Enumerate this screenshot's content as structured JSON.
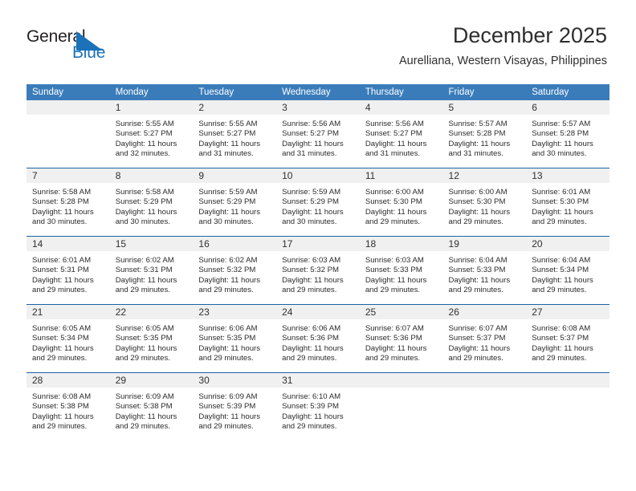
{
  "brand": {
    "name_part1": "General",
    "name_part2": "Blue",
    "logo_colors": {
      "blue": "#1b72b8",
      "dark": "#231f20"
    }
  },
  "header": {
    "title": "December 2025",
    "subtitle": "Aurelliana, Western Visayas, Philippines"
  },
  "colors": {
    "header_blue": "#3a7cba",
    "row_divider_blue": "#1b63a5",
    "daynum_band": "#f0f0f0"
  },
  "weekday_headers": [
    "Sunday",
    "Monday",
    "Tuesday",
    "Wednesday",
    "Thursday",
    "Friday",
    "Saturday"
  ],
  "weeks": [
    [
      {
        "day": "",
        "sunrise": "",
        "sunset": "",
        "daylight_line1": "",
        "daylight_line2": ""
      },
      {
        "day": "1",
        "sunrise": "Sunrise: 5:55 AM",
        "sunset": "Sunset: 5:27 PM",
        "daylight_line1": "Daylight: 11 hours",
        "daylight_line2": "and 32 minutes."
      },
      {
        "day": "2",
        "sunrise": "Sunrise: 5:55 AM",
        "sunset": "Sunset: 5:27 PM",
        "daylight_line1": "Daylight: 11 hours",
        "daylight_line2": "and 31 minutes."
      },
      {
        "day": "3",
        "sunrise": "Sunrise: 5:56 AM",
        "sunset": "Sunset: 5:27 PM",
        "daylight_line1": "Daylight: 11 hours",
        "daylight_line2": "and 31 minutes."
      },
      {
        "day": "4",
        "sunrise": "Sunrise: 5:56 AM",
        "sunset": "Sunset: 5:27 PM",
        "daylight_line1": "Daylight: 11 hours",
        "daylight_line2": "and 31 minutes."
      },
      {
        "day": "5",
        "sunrise": "Sunrise: 5:57 AM",
        "sunset": "Sunset: 5:28 PM",
        "daylight_line1": "Daylight: 11 hours",
        "daylight_line2": "and 31 minutes."
      },
      {
        "day": "6",
        "sunrise": "Sunrise: 5:57 AM",
        "sunset": "Sunset: 5:28 PM",
        "daylight_line1": "Daylight: 11 hours",
        "daylight_line2": "and 30 minutes."
      }
    ],
    [
      {
        "day": "7",
        "sunrise": "Sunrise: 5:58 AM",
        "sunset": "Sunset: 5:28 PM",
        "daylight_line1": "Daylight: 11 hours",
        "daylight_line2": "and 30 minutes."
      },
      {
        "day": "8",
        "sunrise": "Sunrise: 5:58 AM",
        "sunset": "Sunset: 5:29 PM",
        "daylight_line1": "Daylight: 11 hours",
        "daylight_line2": "and 30 minutes."
      },
      {
        "day": "9",
        "sunrise": "Sunrise: 5:59 AM",
        "sunset": "Sunset: 5:29 PM",
        "daylight_line1": "Daylight: 11 hours",
        "daylight_line2": "and 30 minutes."
      },
      {
        "day": "10",
        "sunrise": "Sunrise: 5:59 AM",
        "sunset": "Sunset: 5:29 PM",
        "daylight_line1": "Daylight: 11 hours",
        "daylight_line2": "and 30 minutes."
      },
      {
        "day": "11",
        "sunrise": "Sunrise: 6:00 AM",
        "sunset": "Sunset: 5:30 PM",
        "daylight_line1": "Daylight: 11 hours",
        "daylight_line2": "and 29 minutes."
      },
      {
        "day": "12",
        "sunrise": "Sunrise: 6:00 AM",
        "sunset": "Sunset: 5:30 PM",
        "daylight_line1": "Daylight: 11 hours",
        "daylight_line2": "and 29 minutes."
      },
      {
        "day": "13",
        "sunrise": "Sunrise: 6:01 AM",
        "sunset": "Sunset: 5:30 PM",
        "daylight_line1": "Daylight: 11 hours",
        "daylight_line2": "and 29 minutes."
      }
    ],
    [
      {
        "day": "14",
        "sunrise": "Sunrise: 6:01 AM",
        "sunset": "Sunset: 5:31 PM",
        "daylight_line1": "Daylight: 11 hours",
        "daylight_line2": "and 29 minutes."
      },
      {
        "day": "15",
        "sunrise": "Sunrise: 6:02 AM",
        "sunset": "Sunset: 5:31 PM",
        "daylight_line1": "Daylight: 11 hours",
        "daylight_line2": "and 29 minutes."
      },
      {
        "day": "16",
        "sunrise": "Sunrise: 6:02 AM",
        "sunset": "Sunset: 5:32 PM",
        "daylight_line1": "Daylight: 11 hours",
        "daylight_line2": "and 29 minutes."
      },
      {
        "day": "17",
        "sunrise": "Sunrise: 6:03 AM",
        "sunset": "Sunset: 5:32 PM",
        "daylight_line1": "Daylight: 11 hours",
        "daylight_line2": "and 29 minutes."
      },
      {
        "day": "18",
        "sunrise": "Sunrise: 6:03 AM",
        "sunset": "Sunset: 5:33 PM",
        "daylight_line1": "Daylight: 11 hours",
        "daylight_line2": "and 29 minutes."
      },
      {
        "day": "19",
        "sunrise": "Sunrise: 6:04 AM",
        "sunset": "Sunset: 5:33 PM",
        "daylight_line1": "Daylight: 11 hours",
        "daylight_line2": "and 29 minutes."
      },
      {
        "day": "20",
        "sunrise": "Sunrise: 6:04 AM",
        "sunset": "Sunset: 5:34 PM",
        "daylight_line1": "Daylight: 11 hours",
        "daylight_line2": "and 29 minutes."
      }
    ],
    [
      {
        "day": "21",
        "sunrise": "Sunrise: 6:05 AM",
        "sunset": "Sunset: 5:34 PM",
        "daylight_line1": "Daylight: 11 hours",
        "daylight_line2": "and 29 minutes."
      },
      {
        "day": "22",
        "sunrise": "Sunrise: 6:05 AM",
        "sunset": "Sunset: 5:35 PM",
        "daylight_line1": "Daylight: 11 hours",
        "daylight_line2": "and 29 minutes."
      },
      {
        "day": "23",
        "sunrise": "Sunrise: 6:06 AM",
        "sunset": "Sunset: 5:35 PM",
        "daylight_line1": "Daylight: 11 hours",
        "daylight_line2": "and 29 minutes."
      },
      {
        "day": "24",
        "sunrise": "Sunrise: 6:06 AM",
        "sunset": "Sunset: 5:36 PM",
        "daylight_line1": "Daylight: 11 hours",
        "daylight_line2": "and 29 minutes."
      },
      {
        "day": "25",
        "sunrise": "Sunrise: 6:07 AM",
        "sunset": "Sunset: 5:36 PM",
        "daylight_line1": "Daylight: 11 hours",
        "daylight_line2": "and 29 minutes."
      },
      {
        "day": "26",
        "sunrise": "Sunrise: 6:07 AM",
        "sunset": "Sunset: 5:37 PM",
        "daylight_line1": "Daylight: 11 hours",
        "daylight_line2": "and 29 minutes."
      },
      {
        "day": "27",
        "sunrise": "Sunrise: 6:08 AM",
        "sunset": "Sunset: 5:37 PM",
        "daylight_line1": "Daylight: 11 hours",
        "daylight_line2": "and 29 minutes."
      }
    ],
    [
      {
        "day": "28",
        "sunrise": "Sunrise: 6:08 AM",
        "sunset": "Sunset: 5:38 PM",
        "daylight_line1": "Daylight: 11 hours",
        "daylight_line2": "and 29 minutes."
      },
      {
        "day": "29",
        "sunrise": "Sunrise: 6:09 AM",
        "sunset": "Sunset: 5:38 PM",
        "daylight_line1": "Daylight: 11 hours",
        "daylight_line2": "and 29 minutes."
      },
      {
        "day": "30",
        "sunrise": "Sunrise: 6:09 AM",
        "sunset": "Sunset: 5:39 PM",
        "daylight_line1": "Daylight: 11 hours",
        "daylight_line2": "and 29 minutes."
      },
      {
        "day": "31",
        "sunrise": "Sunrise: 6:10 AM",
        "sunset": "Sunset: 5:39 PM",
        "daylight_line1": "Daylight: 11 hours",
        "daylight_line2": "and 29 minutes."
      },
      {
        "day": "",
        "sunrise": "",
        "sunset": "",
        "daylight_line1": "",
        "daylight_line2": ""
      },
      {
        "day": "",
        "sunrise": "",
        "sunset": "",
        "daylight_line1": "",
        "daylight_line2": ""
      },
      {
        "day": "",
        "sunrise": "",
        "sunset": "",
        "daylight_line1": "",
        "daylight_line2": ""
      }
    ]
  ]
}
